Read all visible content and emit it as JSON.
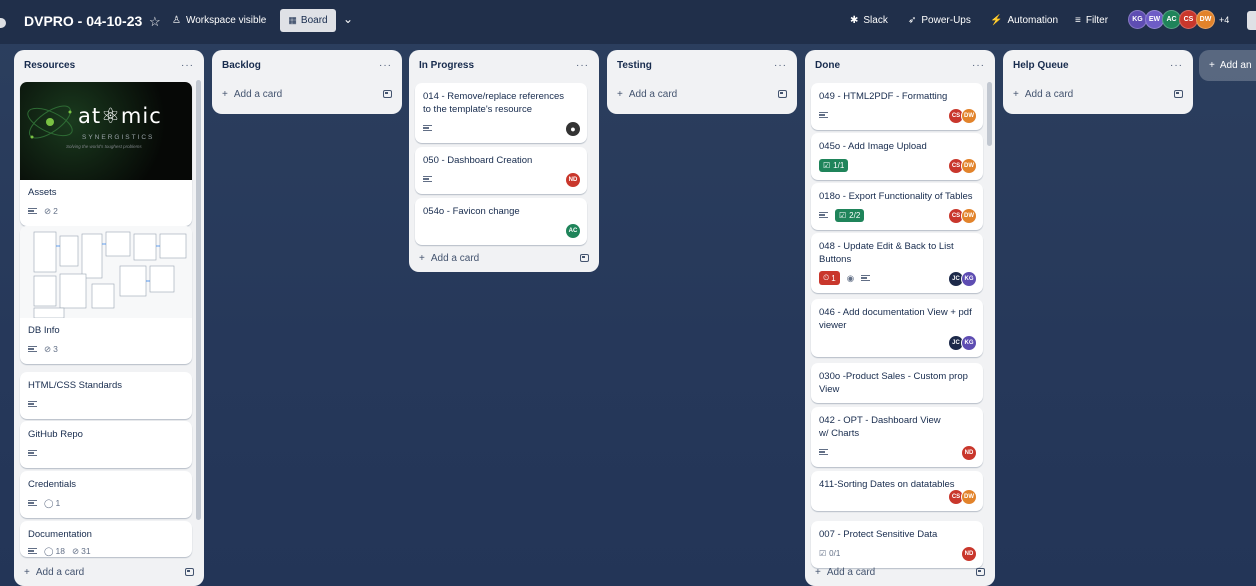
{
  "header": {
    "board_title": "DVPRO - 04-10-23",
    "visibility": "Workspace visible",
    "view_button": "Board",
    "slack": "Slack",
    "powerups": "Power-Ups",
    "automation": "Automation",
    "filter": "Filter",
    "members": [
      {
        "initials": "KG",
        "color": "#5e4db2"
      },
      {
        "initials": "EW",
        "color": "#6e5dc6"
      },
      {
        "initials": "AC",
        "color": "#1f845a"
      },
      {
        "initials": "CS",
        "color": "#c9372c"
      },
      {
        "initials": "DW",
        "color": "#e2832b"
      }
    ],
    "more_members": "+4"
  },
  "add_list": "Add an",
  "add_card": "Add a card",
  "lists": {
    "resources": {
      "title": "Resources",
      "cards": [
        {
          "title": "Assets",
          "attachments": "2",
          "cover_brand": "at⚛mic",
          "cover_sub": "SYNERGISTICS",
          "cover_tag": "Solving the world's toughest problems"
        },
        {
          "title": "DB Info",
          "attachments": "3"
        },
        {
          "title": "HTML/CSS Standards"
        },
        {
          "title": "GitHub Repo"
        },
        {
          "title": "Credentials",
          "comments": "1"
        },
        {
          "title": "Documentation",
          "comments": "18",
          "attachments": "31"
        }
      ]
    },
    "backlog": {
      "title": "Backlog"
    },
    "in_progress": {
      "title": "In Progress",
      "cards": [
        {
          "title": "014 - Remove/replace references to the template's resource"
        },
        {
          "title": "050 - Dashboard Creation",
          "member": "ND"
        },
        {
          "title": "054o - Favicon change",
          "member": "AC"
        }
      ]
    },
    "testing": {
      "title": "Testing"
    },
    "done": {
      "title": "Done",
      "cards": [
        {
          "title": "049 - HTML2PDF - Formatting",
          "members": [
            "CS",
            "DW"
          ]
        },
        {
          "title": "045o - Add Image Upload",
          "checklist": "1/1",
          "members": [
            "CS",
            "DW"
          ]
        },
        {
          "title": "018o - Export Functionality of Tables",
          "checklist": "2/2",
          "members": [
            "CS",
            "DW"
          ]
        },
        {
          "title": "048 - Update Edit & Back to List Buttons",
          "due": "1",
          "members": [
            "JC",
            "KG"
          ]
        },
        {
          "title": "046 - Add documentation View + pdf viewer",
          "members": [
            "JC",
            "KG"
          ]
        },
        {
          "title": "030o -Product Sales - Custom prop View"
        },
        {
          "title": "042 - OPT - Dashboard View w/ Charts",
          "members": [
            "ND"
          ]
        },
        {
          "title": "411-Sorting Dates on datatables",
          "members": [
            "CS",
            "DW"
          ]
        },
        {
          "title": "007 - Protect Sensitive Data",
          "checklist": "0/1",
          "members": [
            "ND"
          ]
        }
      ]
    },
    "help_queue": {
      "title": "Help Queue"
    }
  },
  "colors": {
    "CS": "#c9372c",
    "DW": "#e2832b",
    "ND": "#c9372c",
    "AC": "#1f845a",
    "JC": "#1d2a4a",
    "KG": "#5e4db2"
  }
}
